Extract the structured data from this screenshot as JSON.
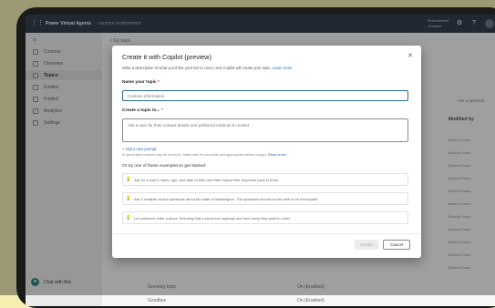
{
  "app": {
    "title": "Power Virtual Agents",
    "environment": "contoso environment",
    "env_label": "Environment",
    "env_value": "Contoso"
  },
  "sidebar": {
    "items": [
      {
        "label": "",
        "icon": "menu-icon"
      },
      {
        "label": "Contoso",
        "icon": "bot-icon"
      },
      {
        "label": "Overview",
        "icon": "home-icon"
      },
      {
        "label": "Topics",
        "icon": "topics-icon",
        "active": true
      },
      {
        "label": "Entities",
        "icon": "entities-icon"
      },
      {
        "label": "Publish",
        "icon": "publish-icon"
      },
      {
        "label": "Analytics",
        "icon": "analytics-icon"
      },
      {
        "label": "Settings",
        "icon": "settings-icon"
      }
    ],
    "footer_label": "Chat with Bot"
  },
  "background": {
    "back_label": "< Go back",
    "right_label": "Ask a question",
    "right_header": "Modified by",
    "right_rows": [
      "Bianca Fuson",
      "Bianca Fuson",
      "Bianca Fuson",
      "Bianca Fuson",
      "Bianca Fuson",
      "Bianca Fuson",
      "Bianca Fuson",
      "Bianca Fuson",
      "Bianca Fuson",
      "Bianca Fuson",
      "Bianca Fuson"
    ],
    "bottom_left_1": "Greeting topic",
    "bottom_left_2": "Goodbye",
    "bottom_mid_1": "On (Enabled)",
    "bottom_mid_2": "On (Enabled)"
  },
  "dialog": {
    "title": "Create it with Copilot (preview)",
    "description": "Write a description of what you'd like your bot to cover, and Copilot will create your topic.",
    "learn_more": "Learn more",
    "name_label": "Name your topic",
    "name_placeholder": "Contoso information",
    "topic_label": "Create a topic to...",
    "topic_placeholder": "Ask a user for their contact details and preferred method of contact",
    "more_link": "+ Add a new prompt",
    "note_text": "AI-generated content may be incorrect. Make sure it's accurate and appropriate before using it.",
    "note_link": "Read terms",
    "examples_label": "Or try one of these examples to get started:",
    "examples": [
      "Ask for a user's name, age, and date of birth and then repeat their response back to them.",
      "Ask 2 multiple choice questions about the state of Washington. The questions should not be able to be interrupted.",
      "Let someone order a pizza. Ensuring that a pizza has toppings and how many they want to order."
    ],
    "create_label": "Create",
    "cancel_label": "Cancel"
  },
  "colors": {
    "page_background": "#f6eeb0",
    "device_frame": "#161616",
    "topbar": "#1f2b3c",
    "accent": "#2a6a9b",
    "help_accent": "#1d7d6b"
  }
}
